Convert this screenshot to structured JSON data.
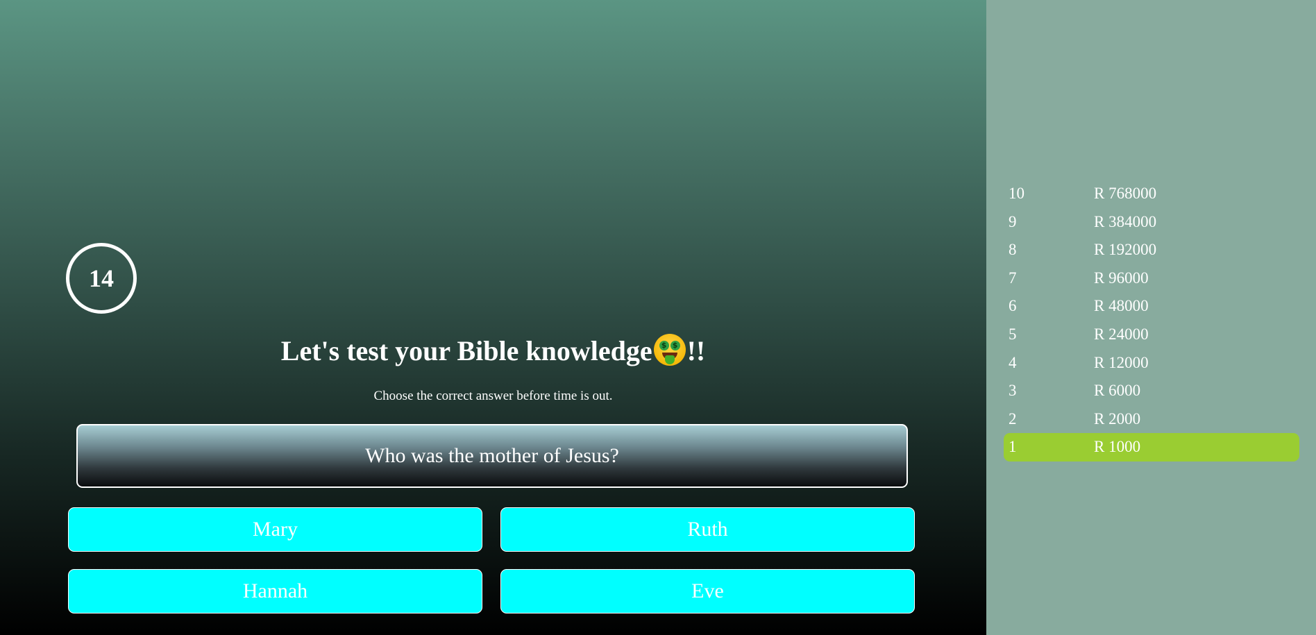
{
  "game": {
    "timer": "14",
    "heading_text": "Let's test your Bible knowledge",
    "heading_suffix": "!!",
    "heading_emoji": "money-mouth-face-icon",
    "subheading": "Choose the correct answer before time is out.",
    "question": "Who was the mother of Jesus?",
    "answers": [
      "Mary",
      "Ruth",
      "Hannah",
      "Eve"
    ]
  },
  "ladder": {
    "active_level": "1",
    "rows": [
      {
        "level": "10",
        "amount": "R 768000"
      },
      {
        "level": "9",
        "amount": "R 384000"
      },
      {
        "level": "8",
        "amount": "R 192000"
      },
      {
        "level": "7",
        "amount": "R 96000"
      },
      {
        "level": "6",
        "amount": "R 48000"
      },
      {
        "level": "5",
        "amount": "R 24000"
      },
      {
        "level": "4",
        "amount": "R 12000"
      },
      {
        "level": "3",
        "amount": "R 6000"
      },
      {
        "level": "2",
        "amount": "R 2000"
      },
      {
        "level": "1",
        "amount": "R 1000"
      }
    ]
  },
  "colors": {
    "answer_bg": "#00ffff",
    "active_level_bg": "#9acd32",
    "sidebar_bg": "#88ab9e"
  }
}
